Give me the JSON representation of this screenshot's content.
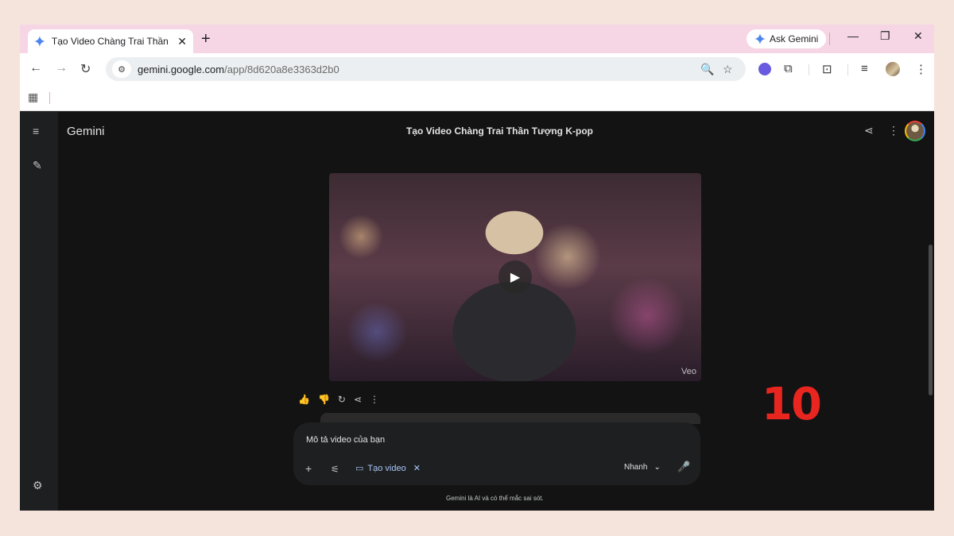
{
  "browser": {
    "tab_title": "Tạo Video Chàng Trai Thần Tượng K-pop",
    "tab_close": "✕",
    "new_tab": "+",
    "ask_gemini": "Ask Gemini",
    "window_controls": {
      "minimize": "—",
      "restore": "❐",
      "close": "✕"
    },
    "nav": {
      "back": "←",
      "forward": "→",
      "reload": "↻"
    },
    "url": {
      "host": "gemini.google.com",
      "path": "/app/8d620a8e3363d2b0"
    },
    "omnibox_icons": {
      "zoom": "🔍",
      "bookmark": "☆"
    },
    "toolbar_icons": [
      "extension-purple-icon",
      "puzzle-icon",
      "media-search-icon",
      "reading-list-icon",
      "profile-avatar-icon",
      "more-vertical-icon"
    ],
    "toolbar_glyphs": {
      "puzzle": "⧉",
      "media": "⊡",
      "reading": "≡",
      "more": "⋮"
    },
    "bookmarks": {
      "apps_glyph": "▦"
    }
  },
  "app": {
    "brand": "Gemini",
    "conversation_title": "Tạo Video Chàng Trai Thần Tượng K-pop",
    "rail_glyphs": {
      "menu": "≡",
      "new_chat": "✎",
      "settings": "⚙"
    },
    "header_glyphs": {
      "share": "⋖",
      "more": "⋮"
    },
    "video": {
      "watermark": "Veo",
      "play_glyph": "▶"
    },
    "response_actions": [
      "👍",
      "👎",
      "↻",
      "⋖",
      "⋮"
    ],
    "composer": {
      "placeholder": "Mô tả video của bạn",
      "add_glyph": "+",
      "tools_glyph": "⚟",
      "chip_icon": "▭",
      "chip_label": "Tạo video",
      "chip_close": "✕",
      "mode_label": "Nhanh",
      "mode_chevron": "⌄",
      "mic_glyph": "🎤"
    },
    "disclaimer": "Gemini là AI và có thể mắc sai sót."
  },
  "overlay": {
    "step_number": "10"
  },
  "colors": {
    "page_bg": "#f5e4dc",
    "tabstrip": "#f6d5e5",
    "app_bg": "#131314",
    "accent_number": "#e8251e",
    "chip": "#a8c7fa"
  }
}
